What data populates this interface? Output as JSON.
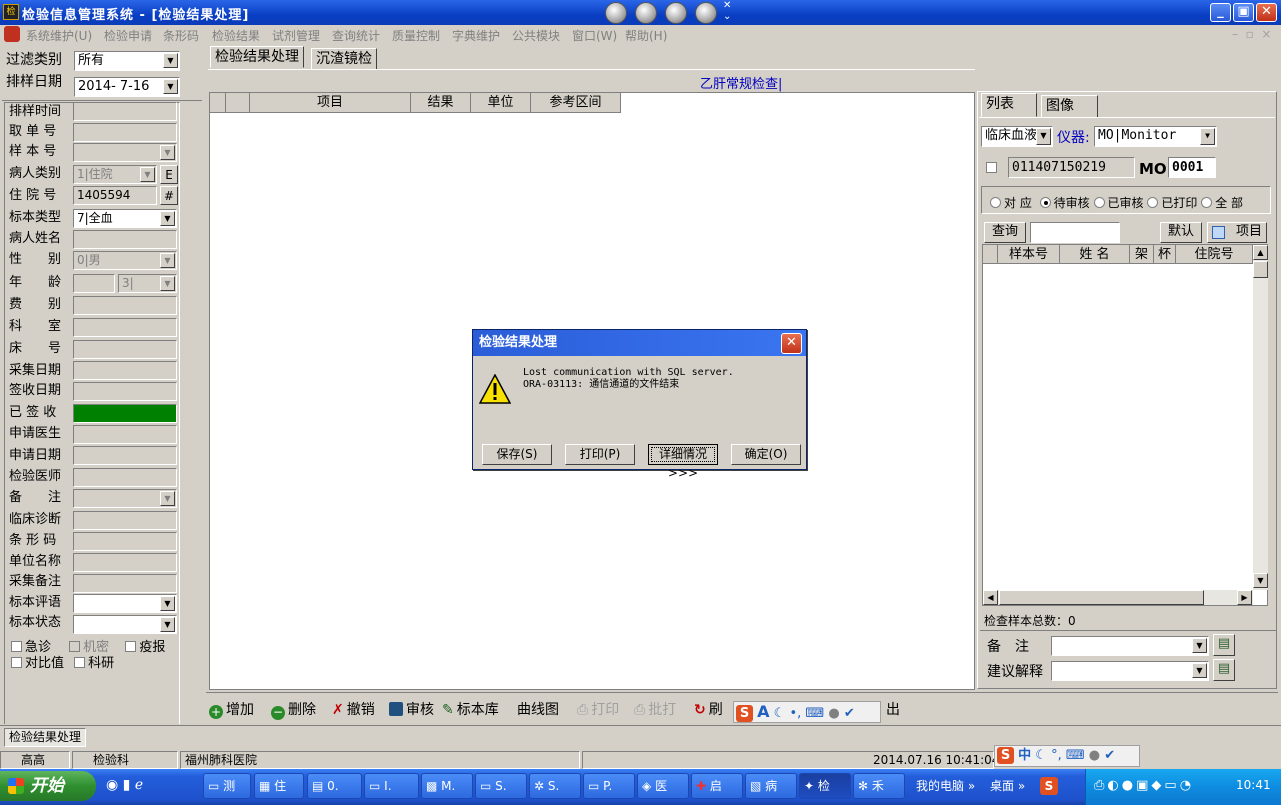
{
  "window": {
    "title": "检验信息管理系统 - [检验结果处理]"
  },
  "menu": [
    "系统维护(U)",
    "检验申请",
    "条形码",
    "检验结果",
    "试剂管理",
    "查询统计",
    "质量控制",
    "字典维护",
    "公共模块",
    "窗口(W)",
    "帮助(H)"
  ],
  "filter": {
    "type_label": "过滤类别",
    "type_value": "所有",
    "date_label": "排样日期",
    "date_value": "2014- 7-16"
  },
  "form": {
    "labels": [
      "排样时间",
      "取 单 号",
      "样 本 号",
      "病人类别",
      "住 院 号",
      "标本类型",
      "病人姓名",
      "性　　别",
      "年　　龄",
      "费　　别",
      "科　　室",
      "床　　号",
      "采集日期",
      "签收日期",
      "已 签 收",
      "申请医生",
      "申请日期",
      "检验医师",
      "备　　注",
      "临床诊断",
      "条 形 码",
      "单位名称",
      "采集备注",
      "标本评语",
      "标本状态"
    ],
    "patient_type_value": "1|住院",
    "patient_type_btn": "E",
    "admission_no": "1405594",
    "admission_btn": "#",
    "specimen_type": "7|全血",
    "gender_value": "0|男",
    "age_unit": "3|",
    "checks": [
      "急诊",
      "机密",
      "疫报",
      "对比值",
      "科研"
    ]
  },
  "tabs": {
    "main": [
      "检验结果处理",
      "沉渣镜检"
    ],
    "right": [
      "列表",
      "图像"
    ]
  },
  "results": {
    "caption": "乙肝常规检查|",
    "columns": [
      "项目",
      "结果",
      "单位",
      "参考区间"
    ]
  },
  "right": {
    "type_select": "临床血液",
    "instrument_label": "仪器:",
    "instrument_value": "MO|Monitor",
    "sample_code": "011407150219",
    "mo_label": "MO",
    "mo_value": "0001",
    "radios": [
      "对 应",
      "待审核",
      "已审核",
      "已打印",
      "全 部"
    ],
    "query_btn": "查询",
    "default_btn": "默认",
    "items_btn": "项目",
    "list_columns": [
      "样本号",
      "姓 名",
      "架",
      "杯",
      "住院号"
    ],
    "total": "检查样本总数：0",
    "remark_label": "备　注",
    "advice_label": "建议解释"
  },
  "toolbar": {
    "add": "增加",
    "delete": "删除",
    "cancel": "撤销",
    "audit": "审核",
    "lib": "标本库",
    "curve": "曲线图",
    "print": "打印",
    "batch": "批打",
    "refresh": "刷",
    "exit": "出"
  },
  "mdi_tab": "检验结果处理",
  "status": {
    "user": "高高",
    "dept": "检验科",
    "hospital": "福州肺科医院",
    "datetime": "2014.07.16  10:41:04"
  },
  "dialog": {
    "title": "检验结果处理",
    "line1": "Lost communication with SQL server.",
    "line2": "ORA-03113: 通信通道的文件结束",
    "buttons": [
      "保存(S)",
      "打印(P)",
      "详细情况>>>",
      "确定(O)"
    ]
  },
  "taskbar": {
    "start": "开始",
    "items": [
      "测",
      "住",
      "0.",
      "I.",
      "M.",
      "S.",
      "S.",
      "P.",
      "医",
      "启",
      "病",
      "检",
      "禾"
    ],
    "tray_my_pc": "我的电脑",
    "tray_desktop": "桌面",
    "clock": "10:41"
  },
  "ime": {
    "lang": "中"
  },
  "colors": {
    "signed": "#008000",
    "title_blue": "#0a3fc4"
  }
}
